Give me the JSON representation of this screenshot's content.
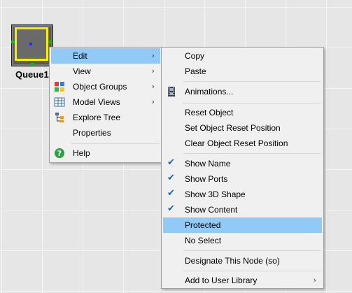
{
  "node": {
    "label": "Queue1"
  },
  "context_menu": {
    "items": [
      {
        "label": "Edit",
        "has_submenu": true
      },
      {
        "label": "View",
        "has_submenu": true
      },
      {
        "label": "Object Groups",
        "has_submenu": true,
        "icon": "object-groups-icon"
      },
      {
        "label": "Model Views",
        "has_submenu": true,
        "icon": "model-views-icon"
      },
      {
        "label": "Explore Tree",
        "icon": "tree-icon"
      },
      {
        "label": "Properties"
      },
      {
        "label": "Help",
        "icon": "help-icon"
      }
    ],
    "submenu_arrow": "›"
  },
  "edit_submenu": {
    "items": [
      {
        "label": "Copy"
      },
      {
        "label": "Paste"
      },
      {
        "label": "Animations...",
        "icon": "film-icon"
      },
      {
        "label": "Reset Object"
      },
      {
        "label": "Set Object Reset Position"
      },
      {
        "label": "Clear Object Reset Position"
      },
      {
        "label": "Show Name",
        "checked": true
      },
      {
        "label": "Show Ports",
        "checked": true
      },
      {
        "label": "Show 3D Shape",
        "checked": true
      },
      {
        "label": "Show Content",
        "checked": true
      },
      {
        "label": "Protected",
        "highlighted": true
      },
      {
        "label": "No Select"
      },
      {
        "label": "Designate This Node (so)"
      },
      {
        "label": "Add to User Library",
        "has_submenu": true
      }
    ],
    "check_glyph": "✔"
  },
  "colors": {
    "highlight": "#91c9f7",
    "selection": "#f4f000",
    "check": "#1f5fa8"
  }
}
